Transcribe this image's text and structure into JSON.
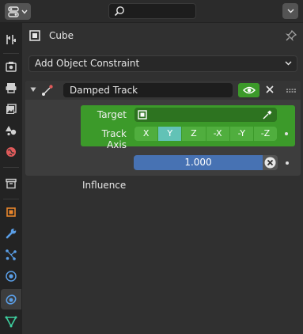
{
  "object": {
    "name": "Cube"
  },
  "add_constraint": {
    "label": "Add Object Constraint"
  },
  "constraint": {
    "name": "Damped Track",
    "target_label": "Target",
    "track_axis_label": "Track Axis",
    "axes": [
      "X",
      "Y",
      "Z",
      "-X",
      "-Y",
      "-Z"
    ],
    "selected_axis": "Y",
    "influence_label": "Influence",
    "influence_value": "1.000"
  },
  "colors": {
    "accent_green": "#3c9a2a",
    "selected_axis": "#62c2b6",
    "influence_blue": "#4772b3"
  },
  "tabs": [
    "tool-tab",
    "render-tab",
    "output-tab",
    "view-layer-tab",
    "scene-tab",
    "world-tab",
    "collection-tab",
    "object-tab",
    "modifier-tab",
    "particles-tab",
    "physics-tab",
    "object-constraint-tab",
    "object-data-tab"
  ]
}
